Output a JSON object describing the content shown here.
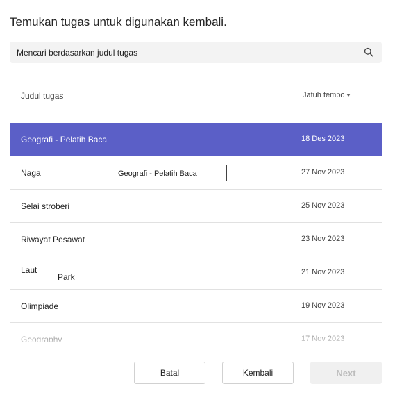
{
  "page": {
    "title": "Temukan tugas untuk digunakan kembali."
  },
  "search": {
    "placeholder": "Mencari berdasarkan judul tugas",
    "icon": "search-icon"
  },
  "table": {
    "headers": {
      "title": "Judul tugas",
      "due": "Jatuh tempo"
    },
    "rows": [
      {
        "name": "Geografi - Pelatih Baca",
        "due": "18 Des 2023",
        "selected": true
      },
      {
        "name": "Naga",
        "due": "27 Nov 2023"
      },
      {
        "name": "Selai stroberi",
        "due": "25 Nov 2023"
      },
      {
        "name": "Riwayat Pesawat",
        "due": "23 Nov 2023"
      },
      {
        "name": "Laut",
        "name_extra": "Park",
        "due": "21 Nov 2023"
      },
      {
        "name": "Olimpiade",
        "due": "19 Nov 2023"
      },
      {
        "name": "Geography",
        "due": "17 Nov 2023"
      }
    ]
  },
  "tooltip": {
    "text": "Geografi - Pelatih Baca"
  },
  "buttons": {
    "cancel": "Batal",
    "back": "Kembali",
    "next": "Next"
  },
  "colors": {
    "accent": "#5b5fc7",
    "disabled_bg": "#f0f0f0",
    "disabled_text": "#bdbdbd"
  }
}
